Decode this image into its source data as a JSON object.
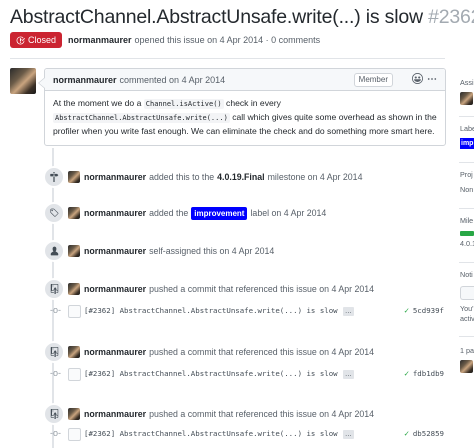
{
  "issue": {
    "title": "AbstractChannel.AbstractUnsafe.write(...) is slow",
    "number": "#2362",
    "state": "Closed",
    "author": "normanmaurer",
    "opened_text": "opened this issue on 4 Apr 2014 · 0 comments"
  },
  "comment": {
    "author": "normanmaurer",
    "action": "commented on 4 Apr 2014",
    "role_badge": "Member",
    "body_part1": "At the moment we do a",
    "code1": "Channel.isActive()",
    "body_part2": "check in every",
    "code2": "AbstractChannel.AbstractUnsafe.write(...)",
    "body_part3": "call which gives quite some overhead as shown in the",
    "body_line3": "profiler when you write fast enough. We can eliminate the check and do something more smart here."
  },
  "timeline": {
    "milestone": {
      "author": "normanmaurer",
      "pre": "added this to the",
      "name": "4.0.19.Final",
      "post": "milestone on 4 Apr 2014"
    },
    "label": {
      "author": "normanmaurer",
      "pre": "added the",
      "name": "improvement",
      "post": "label on 4 Apr 2014"
    },
    "assign": {
      "author": "normanmaurer",
      "text": "self-assigned this on 4 Apr 2014"
    },
    "pushes": [
      {
        "author": "normanmaurer",
        "text": "pushed a commit that referenced this issue on 4 Apr 2014",
        "commit_msg": "[#2362] AbstractChannel.AbstractUnsafe.write(...) is slow",
        "more": "…",
        "sha": "5cd939f"
      },
      {
        "author": "normanmaurer",
        "text": "pushed a commit that referenced this issue on 4 Apr 2014",
        "commit_msg": "[#2362] AbstractChannel.AbstractUnsafe.write(...) is slow",
        "more": "…",
        "sha": "fdb1db9"
      },
      {
        "author": "normanmaurer",
        "text": "pushed a commit that referenced this issue on 4 Apr 2014",
        "commit_msg": "[#2362] AbstractChannel.AbstractUnsafe.write(...) is slow",
        "more": "…",
        "sha": "db52859"
      }
    ]
  },
  "sidebar": {
    "assignees_label": "Assi",
    "labels_label": "Labe",
    "label_chip": "imp",
    "projects_label": "Proj",
    "projects_value": "Non",
    "milestone_label": "Mile",
    "milestone_progress": 1.0,
    "milestone_value": "4.0.1",
    "notifications_label": "Noti",
    "notifications_text": "You'",
    "notifications_text2": "activ",
    "participants_label": "1 pa"
  },
  "icons": {
    "closed": "issue-closed-icon",
    "kebab": "kebab-icon",
    "reaction": "smiley-icon",
    "milestone": "milestone-icon",
    "tag": "tag-icon",
    "person": "person-icon",
    "repo_push": "repo-push-icon",
    "commit": "git-commit-icon",
    "check": "check-icon"
  },
  "colors": {
    "closed_red": "#cb2431",
    "improvement_label": "#0000ff",
    "success_green": "#28a745"
  }
}
